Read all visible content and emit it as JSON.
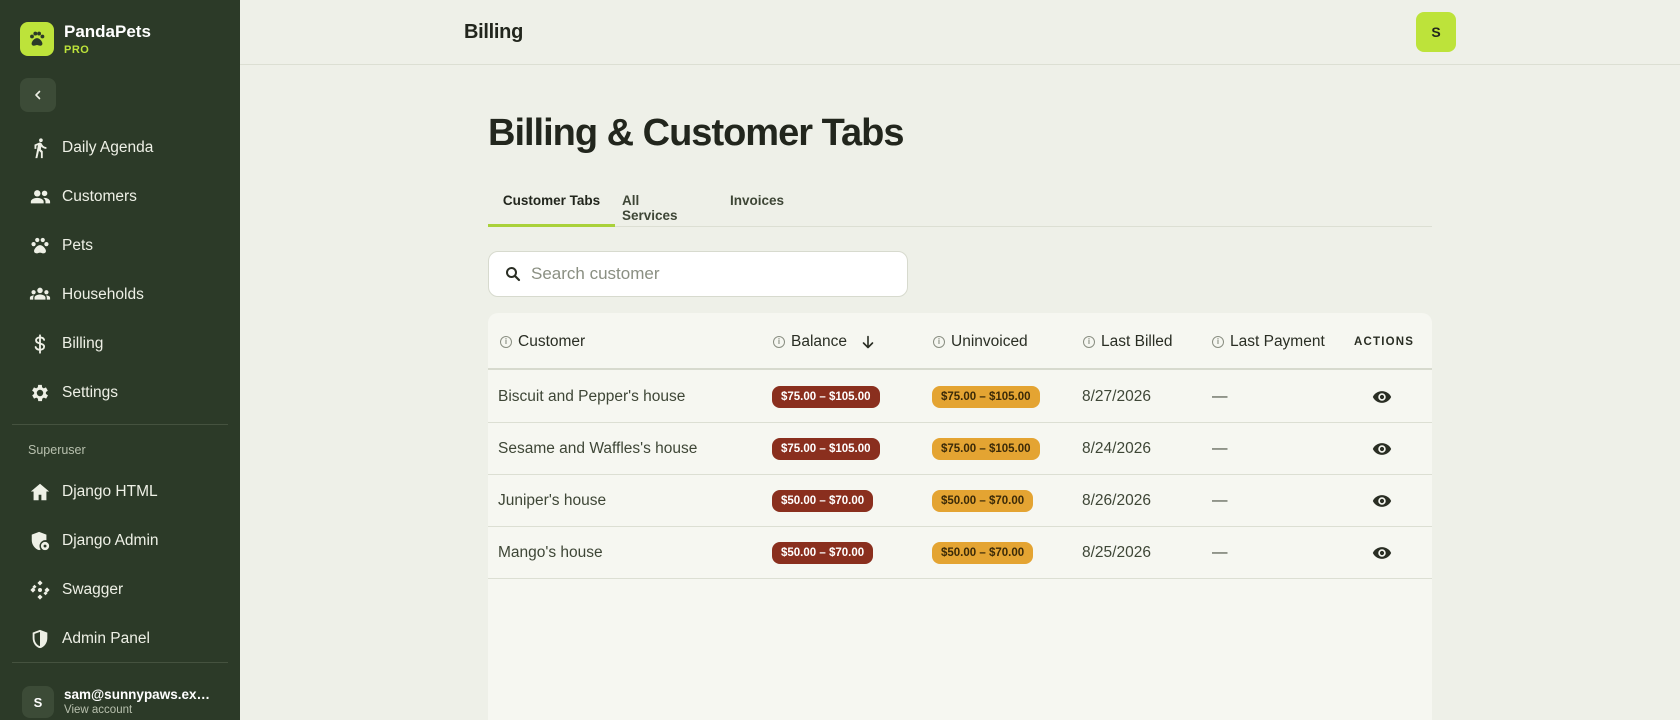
{
  "brand": {
    "name": "PandaPets",
    "tier": "PRO"
  },
  "sidebar": {
    "items": [
      {
        "label": "Daily Agenda",
        "icon": "walk-icon"
      },
      {
        "label": "Customers",
        "icon": "people-icon"
      },
      {
        "label": "Pets",
        "icon": "paw-icon"
      },
      {
        "label": "Households",
        "icon": "group-icon"
      },
      {
        "label": "Billing",
        "icon": "dollar-icon"
      },
      {
        "label": "Settings",
        "icon": "gear-icon"
      }
    ],
    "section_label": "Superuser",
    "superuser_items": [
      {
        "label": "Django HTML",
        "icon": "home-icon"
      },
      {
        "label": "Django Admin",
        "icon": "shield-gear-icon"
      },
      {
        "label": "Swagger",
        "icon": "swagger-icon"
      },
      {
        "label": "Admin Panel",
        "icon": "shield-icon"
      }
    ],
    "account": {
      "avatar": "S",
      "email": "sam@sunnypaws.example.com",
      "view_label": "View account"
    }
  },
  "header": {
    "title": "Billing",
    "avatar": "S"
  },
  "main": {
    "title": "Billing & Customer Tabs",
    "tabs": [
      {
        "label": "Customer Tabs",
        "active": true
      },
      {
        "label": "All Services",
        "active": false
      },
      {
        "label": "Invoices",
        "active": false
      }
    ],
    "search": {
      "placeholder": "Search customer",
      "value": ""
    },
    "table": {
      "columns": [
        "Customer",
        "Balance",
        "Uninvoiced",
        "Last Billed",
        "Last Payment",
        "ACTIONS"
      ],
      "sort": {
        "column": "Balance",
        "direction": "desc"
      },
      "rows": [
        {
          "customer": "Biscuit and Pepper's house",
          "balance": "$75.00 – $105.00",
          "uninvoiced": "$75.00 – $105.00",
          "last_billed": "8/27/2026",
          "last_payment": "—"
        },
        {
          "customer": "Sesame and Waffles's house",
          "balance": "$75.00 – $105.00",
          "uninvoiced": "$75.00 – $105.00",
          "last_billed": "8/24/2026",
          "last_payment": "—"
        },
        {
          "customer": "Juniper's house",
          "balance": "$50.00 – $70.00",
          "uninvoiced": "$50.00 – $70.00",
          "last_billed": "8/26/2026",
          "last_payment": "—"
        },
        {
          "customer": "Mango's house",
          "balance": "$50.00 – $70.00",
          "uninvoiced": "$50.00 – $70.00",
          "last_billed": "8/25/2026",
          "last_payment": "—"
        }
      ]
    }
  },
  "colors": {
    "sidebar_bg": "#2c3a28",
    "accent": "#bde33a",
    "balance_badge": "#8a2f1e",
    "uninvoiced_badge": "#e4a432",
    "page_bg": "#eef0e8"
  }
}
